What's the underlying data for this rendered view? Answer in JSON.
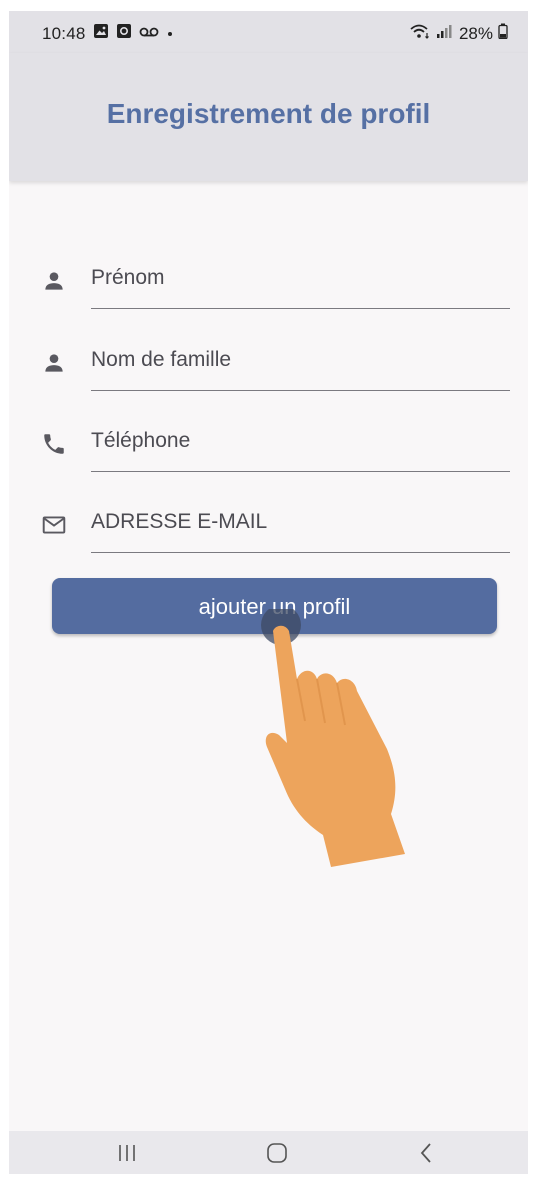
{
  "status_bar": {
    "time": "10:48",
    "battery": "28%"
  },
  "app_bar": {
    "title": "Enregistrement de profil"
  },
  "form": {
    "fields": [
      {
        "label": "Prénom",
        "icon": "person-icon"
      },
      {
        "label": "Nom de famille",
        "icon": "person-icon"
      },
      {
        "label": "Téléphone",
        "icon": "phone-icon"
      },
      {
        "label": "ADRESSE E-MAIL",
        "icon": "mail-icon"
      }
    ],
    "submit_label": "ajouter un profil"
  },
  "colors": {
    "accent": "#546ca0",
    "title": "#5670a4",
    "app_bar_bg": "#e2e1e6",
    "page_bg": "#f9f7f8",
    "tap_hand": "#eda45c"
  },
  "nav_bar": {
    "buttons": [
      "recent-apps-icon",
      "home-icon",
      "back-icon"
    ]
  }
}
